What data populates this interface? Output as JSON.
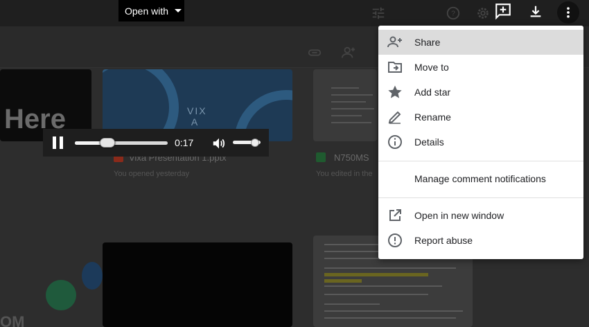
{
  "background": {
    "left_card_text": "Here",
    "file1": {
      "name": "Vixa Presentation 1.pptx",
      "sub": "You opened yesterday",
      "thumb_text": "VIX\nA"
    },
    "file2": {
      "name": "N750MS",
      "sub": "You edited in the"
    },
    "bottom_left_text": "OM"
  },
  "toolbar": {
    "open_with_label": "Open with",
    "icons": [
      "filter-icon",
      "help-icon",
      "settings-icon",
      "add-comment-icon",
      "download-icon",
      "more-vert-icon",
      "link-icon",
      "add-person-icon"
    ]
  },
  "player": {
    "elapsed": "0:17",
    "progress_fraction": 0.35,
    "volume_fraction": 0.8
  },
  "menu": {
    "items": [
      {
        "label": "Share",
        "icon": "person-add-icon",
        "highlighted": true
      },
      {
        "label": "Move to",
        "icon": "move-to-folder-icon"
      },
      {
        "label": "Add star",
        "icon": "star-icon"
      },
      {
        "label": "Rename",
        "icon": "pencil-icon"
      },
      {
        "label": "Details",
        "icon": "info-icon"
      },
      {
        "label": "Manage comment notifications",
        "icon": ""
      },
      {
        "label": "Open in new window",
        "icon": "open-in-new-icon"
      },
      {
        "label": "Report abuse",
        "icon": "report-icon"
      }
    ]
  },
  "colors": {
    "menu_highlight": "#dcdcdc",
    "menu_bg": "#ffffff",
    "menu_text": "#202124",
    "icon_gray": "#5f6368",
    "overlay": "#2d2d2d"
  }
}
